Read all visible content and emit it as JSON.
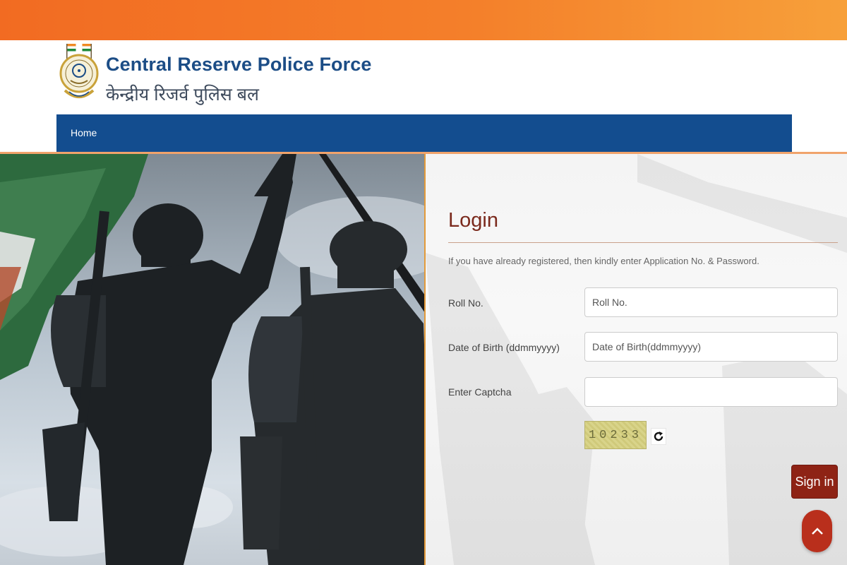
{
  "header": {
    "brand_name_en": "Central Reserve Police Force",
    "brand_name_hi": "केन्द्रीय रिजर्व पुलिस बल",
    "logo_icon": "crpf-emblem-icon"
  },
  "nav": {
    "items": [
      {
        "label": "Home"
      }
    ]
  },
  "login": {
    "title": "Login",
    "intro": "If you have already registered, then kindly enter Application No. & Password.",
    "fields": [
      {
        "label": "Roll No.",
        "value": "",
        "placeholder": "Roll No."
      },
      {
        "label": "Date of Birth (ddmmyyyy)",
        "value": "",
        "placeholder": "Date of Birth(ddmmyyyy)"
      },
      {
        "label": "Enter Captcha",
        "value": "",
        "placeholder": ""
      }
    ],
    "captcha_text": "10233",
    "refresh_icon": "refresh-icon",
    "submit_label": "Sign in"
  },
  "scroll_top_icon": "chevron-up-icon",
  "colors": {
    "top_bar": "#f47f2a",
    "nav_bar": "#134d8f",
    "brand_text": "#1c4d86",
    "login_title": "#7b2a1d",
    "sign_in_button": "#8e2315",
    "scroll_top_button": "#b92f1c"
  }
}
